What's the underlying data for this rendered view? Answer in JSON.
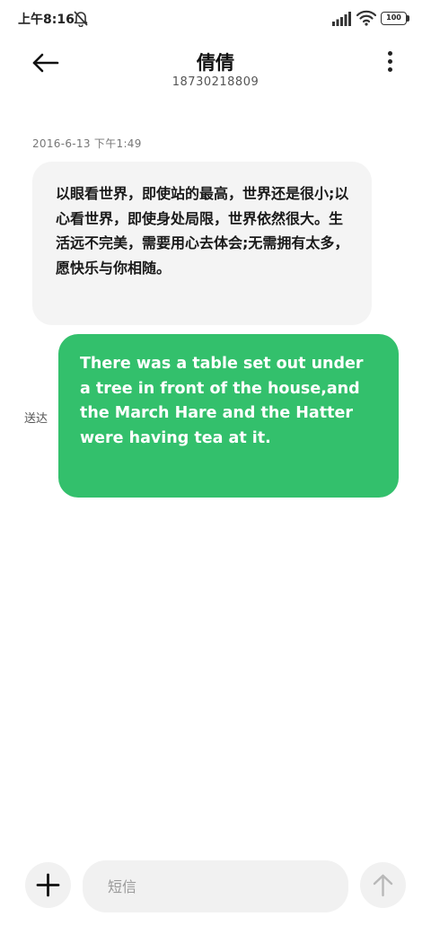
{
  "status_bar": {
    "time": "上午8:16",
    "battery_level": "100",
    "icons": [
      "mute-icon",
      "signal-icon",
      "wifi-icon",
      "battery-icon"
    ]
  },
  "header": {
    "contact_name": "倩倩",
    "contact_number": "18730218809",
    "icons": [
      "back-arrow-icon",
      "more-menu-icon"
    ]
  },
  "conversation": {
    "timestamp": "2016-6-13 下午1:49",
    "messages": [
      {
        "direction": "incoming",
        "text": "以眼看世界，即使站的最高，世界还是很小;以心看世界，即使身处局限，世界依然很大。生活远不完美，需要用心去体会;无需拥有太多，愿快乐与你相随。"
      },
      {
        "direction": "outgoing",
        "status": "送达",
        "text": "There was a table set out under a tree in front of the house,and the March Hare and the Hatter were having tea at it."
      }
    ]
  },
  "composer": {
    "placeholder": "短信",
    "value": "",
    "icons": [
      "plus-icon",
      "send-arrow-icon"
    ]
  },
  "colors": {
    "outgoing_bubble": "#33c06c",
    "incoming_bubble": "#f4f4f4",
    "background": "#ffffff"
  }
}
